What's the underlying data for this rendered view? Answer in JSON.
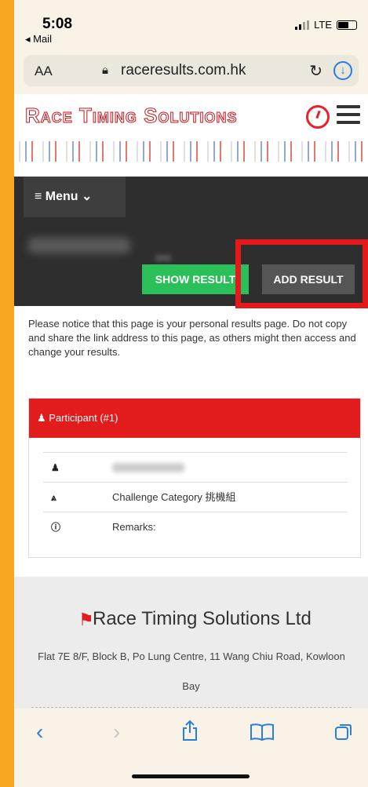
{
  "status_bar": {
    "time": "5:08",
    "back_app": "◂ Mail",
    "network": "LTE"
  },
  "browser": {
    "text_size": "AA",
    "url": "raceresults.com.hk",
    "reload_icon": "reload-icon",
    "download_icon": "download-icon"
  },
  "site": {
    "logo_text": "Race Timing Solutions",
    "menu_label": "≡ Menu ⌄"
  },
  "participant_header": {
    "show_result_label": "SHOW RESULT",
    "add_result_label": "ADD RESULT",
    "highlight_color": "#e51919"
  },
  "notice": "Please notice that this page is your personal results page. Do not copy and share the link address to this page, as others might then access and change your results.",
  "card": {
    "title": "Participant (#1)",
    "rows": [
      {
        "icon": "user-icon",
        "text": ""
      },
      {
        "icon": "road-icon",
        "text": "Challenge Category 挑機組"
      },
      {
        "icon": "info-icon",
        "text": "Remarks:"
      }
    ]
  },
  "footer": {
    "company": "Race Timing Solutions Ltd",
    "address_line1": "Flat 7E 8/F, Block B, Po Lung Centre, 11 Wang Chiu Road, Kowloon",
    "address_line2": "Bay"
  },
  "colors": {
    "accent_red": "#e21c1c",
    "show_green": "#2bbf5a",
    "ios_blue": "#2a7de1"
  }
}
